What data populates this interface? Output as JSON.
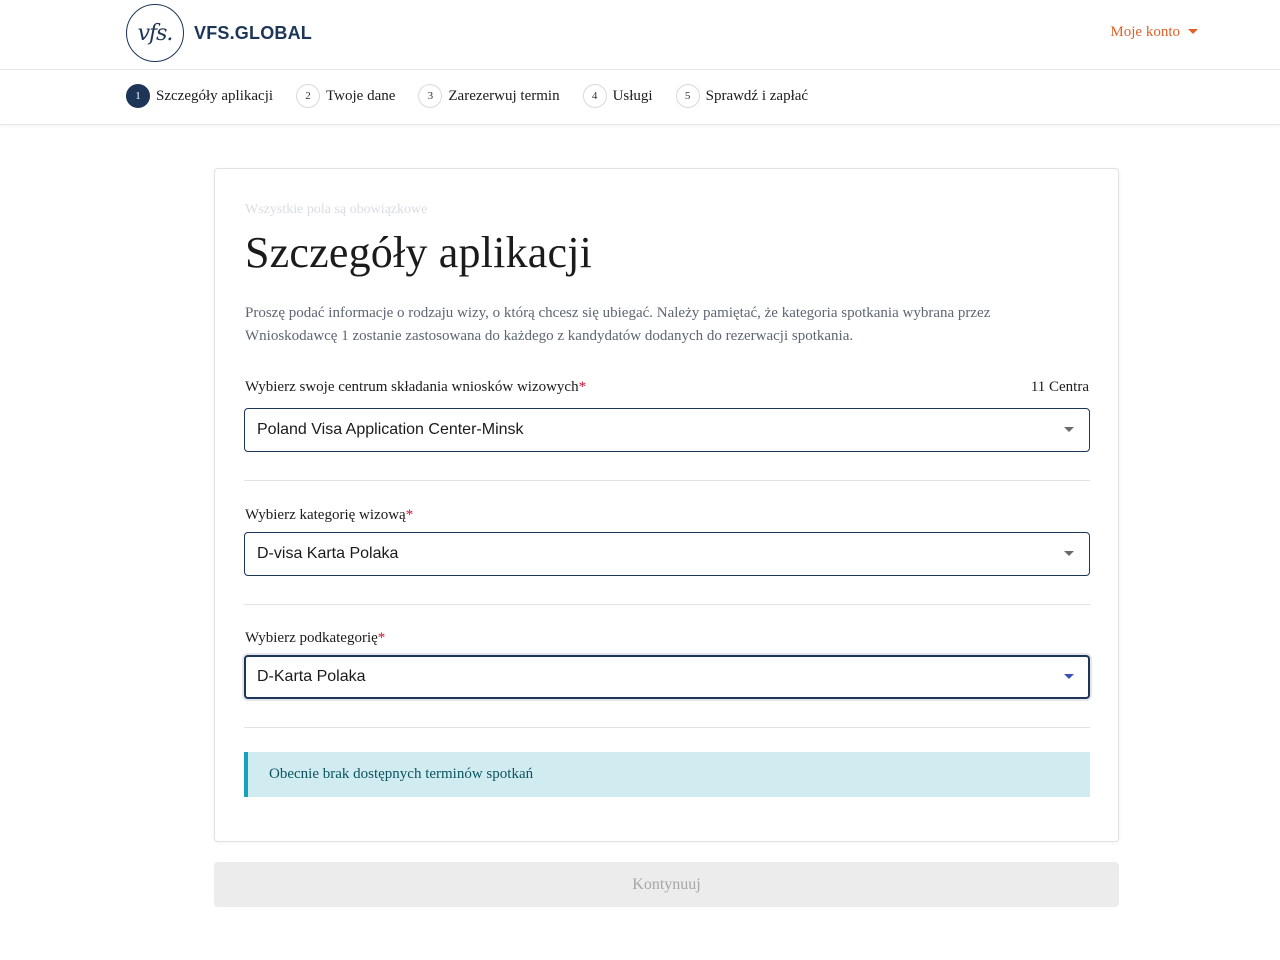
{
  "brand": {
    "logo_mark": "vfs.",
    "logo_text": "VFS.GLOBAL",
    "colors": {
      "navy": "#1d3557",
      "accent_orange": "#e0612a",
      "alert_bg": "#d1ecf1",
      "alert_border": "#17a2b8"
    }
  },
  "header": {
    "account_label": "Moje konto",
    "account_icon": "caret-down-icon"
  },
  "stepper": {
    "steps": [
      {
        "num": "1",
        "label": "Szczegóły aplikacji",
        "active": true
      },
      {
        "num": "2",
        "label": "Twoje dane",
        "active": false
      },
      {
        "num": "3",
        "label": "Zarezerwuj termin",
        "active": false
      },
      {
        "num": "4",
        "label": "Usługi",
        "active": false
      },
      {
        "num": "5",
        "label": "Sprawdź i zapłać",
        "active": false
      }
    ]
  },
  "form": {
    "required_note": "Wszystkie pola są obowiązkowe",
    "title": "Szczegóły aplikacji",
    "intro": "Proszę podać informacje o rodzaju wizy, o którą chcesz się ubiegać. Należy pamiętać, że kategoria spotkania wybrana przez Wnioskodawcę 1 zostanie zastosowana do każdego z kandydatów dodanych do rezerwacji spotkania.",
    "required_marker": "*",
    "centre": {
      "label": "Wybierz swoje centrum składania wniosków wizowych",
      "count": "11 Centra",
      "value": "Poland Visa Application Center-Minsk"
    },
    "category": {
      "label": "Wybierz kategorię wizową",
      "value": "D-visa Karta Polaka"
    },
    "subcategory": {
      "label": "Wybierz podkategorię",
      "value": "D-Karta Polaka"
    },
    "alert": "Obecnie brak dostępnych terminów spotkań"
  },
  "actions": {
    "continue_label": "Kontynuuj",
    "continue_disabled": true
  }
}
